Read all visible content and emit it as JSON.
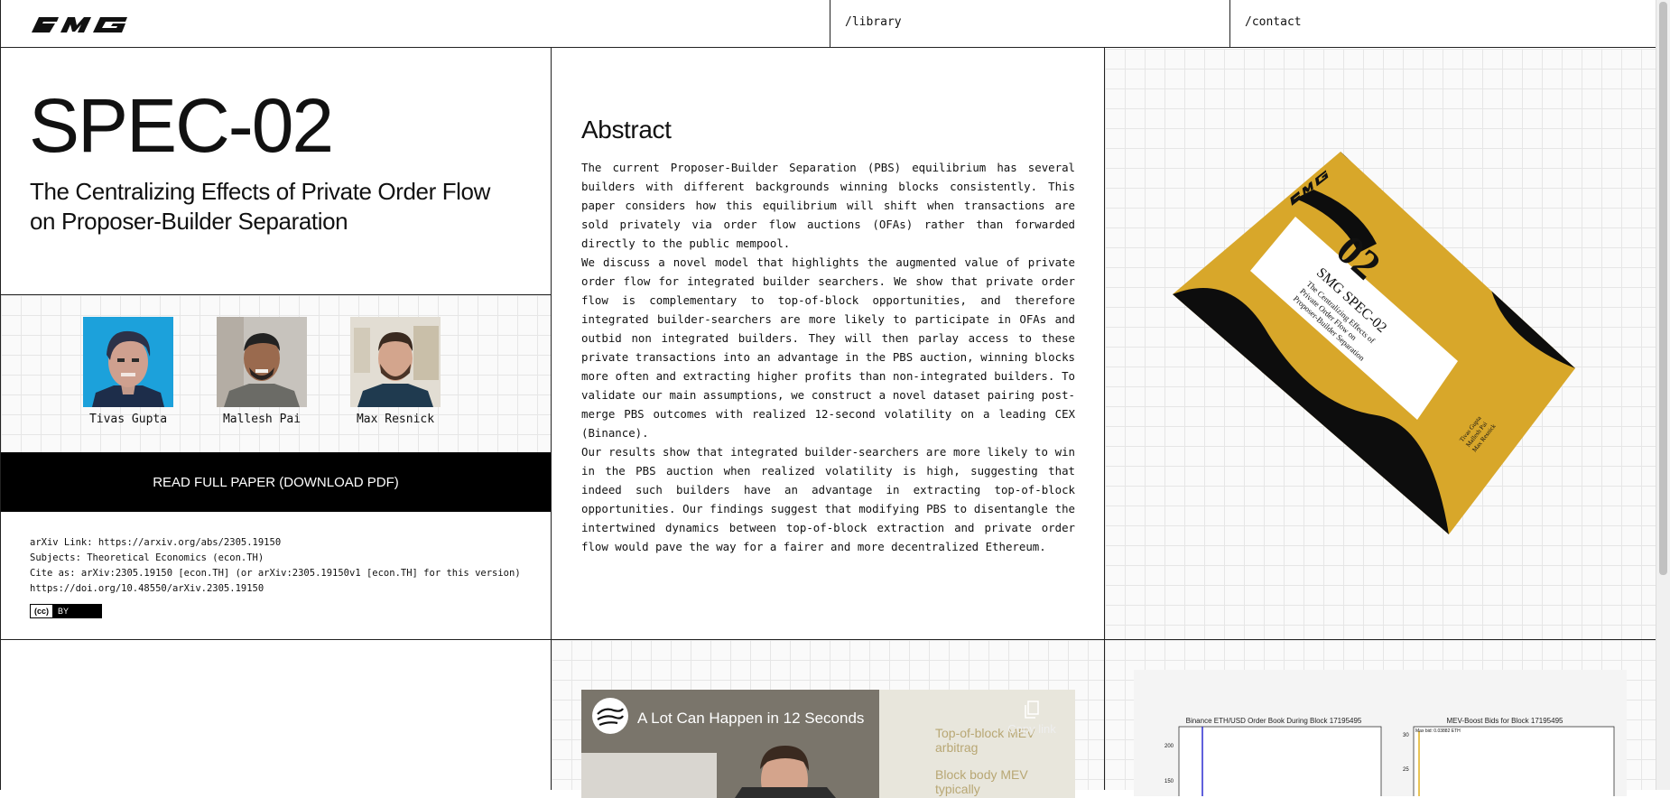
{
  "header": {
    "logo_text": "SMG",
    "nav": [
      {
        "label": "/library"
      },
      {
        "label": "/contact"
      }
    ]
  },
  "paper": {
    "id": "SPEC-02",
    "title": "The Centralizing Effects of Private Order Flow on Proposer-Builder Separation"
  },
  "authors": [
    {
      "name": "Tivas Gupta",
      "avatar_icon": "pixel-portrait"
    },
    {
      "name": "Mallesh Pai",
      "avatar_icon": "photo-portrait"
    },
    {
      "name": "Max Resnick",
      "avatar_icon": "photo-portrait"
    }
  ],
  "read_button": "READ FULL PAPER (DOWNLOAD PDF)",
  "meta": {
    "arxiv_link": "arXiv Link: https://arxiv.org/abs/2305.19150",
    "subjects": "Subjects: Theoretical Economics (econ.TH)",
    "cite_as": "Cite as: arXiv:2305.19150 [econ.TH] (or arXiv:2305.19150v1 [econ.TH] for this version)",
    "doi": "https://doi.org/10.48550/arXiv.2305.19150",
    "license_cc": "(cc)",
    "license_by": "BY"
  },
  "abstract": {
    "heading": "Abstract",
    "paragraphs": [
      "The current Proposer-Builder Separation (PBS) equilibrium has several builders with different backgrounds winning blocks consistently. This paper considers how this equilibrium will shift when transactions are sold privately via order flow auctions (OFAs) rather than forwarded directly to the public mempool.",
      "We discuss a novel model that highlights the augmented value of private order flow for integrated builder searchers. We show that private order flow is complementary to top-of-block opportunities, and therefore integrated builder-searchers are more likely to participate in OFAs and outbid non integrated builders. They will then parlay access to these private transactions into an advantage in the PBS auction, winning blocks more often and extracting higher profits than non-integrated builders. To validate our main assumptions, we construct a novel dataset pairing post-merge PBS outcomes with realized 12-second volatility on a leading CEX (Binance).",
      "Our results show that integrated builder-searchers are more likely to win in the PBS auction when realized volatility is high, suggesting that indeed such builders have an advantage in extracting top-of-block opportunities. Our findings suggest that modifying PBS to disentangle the intertwined dynamics between top-of-block extraction and private order flow would pave the way for a fairer and more decentralized Ethereum."
    ]
  },
  "cover": {
    "number": "02",
    "series": "SMG SPEC-02",
    "title_lines": [
      "The Centralizing Effects of",
      "Private Order Flow on",
      "Proposer-Builder Separation"
    ],
    "authors": [
      "Tivas Gupta",
      "Mallesh Pai",
      "Max Resnick"
    ],
    "accent_color": "#d8a72a"
  },
  "video": {
    "title": "A Lot Can Happen in 12 Seconds",
    "copy_label": "Copy link",
    "slide_lines": [
      "Top-of-block MEV arbitrag",
      "Block body MEV typically"
    ]
  },
  "charts": {
    "left_title": "Binance ETH/USD Order Book During Block 17195495",
    "left_ticks": [
      "200",
      "150"
    ],
    "right_title": "MEV-Boost Bids for Block 17195495",
    "right_ticks": [
      "30",
      "25"
    ],
    "right_annotation": "Max bid: 0.03882 ETH"
  }
}
